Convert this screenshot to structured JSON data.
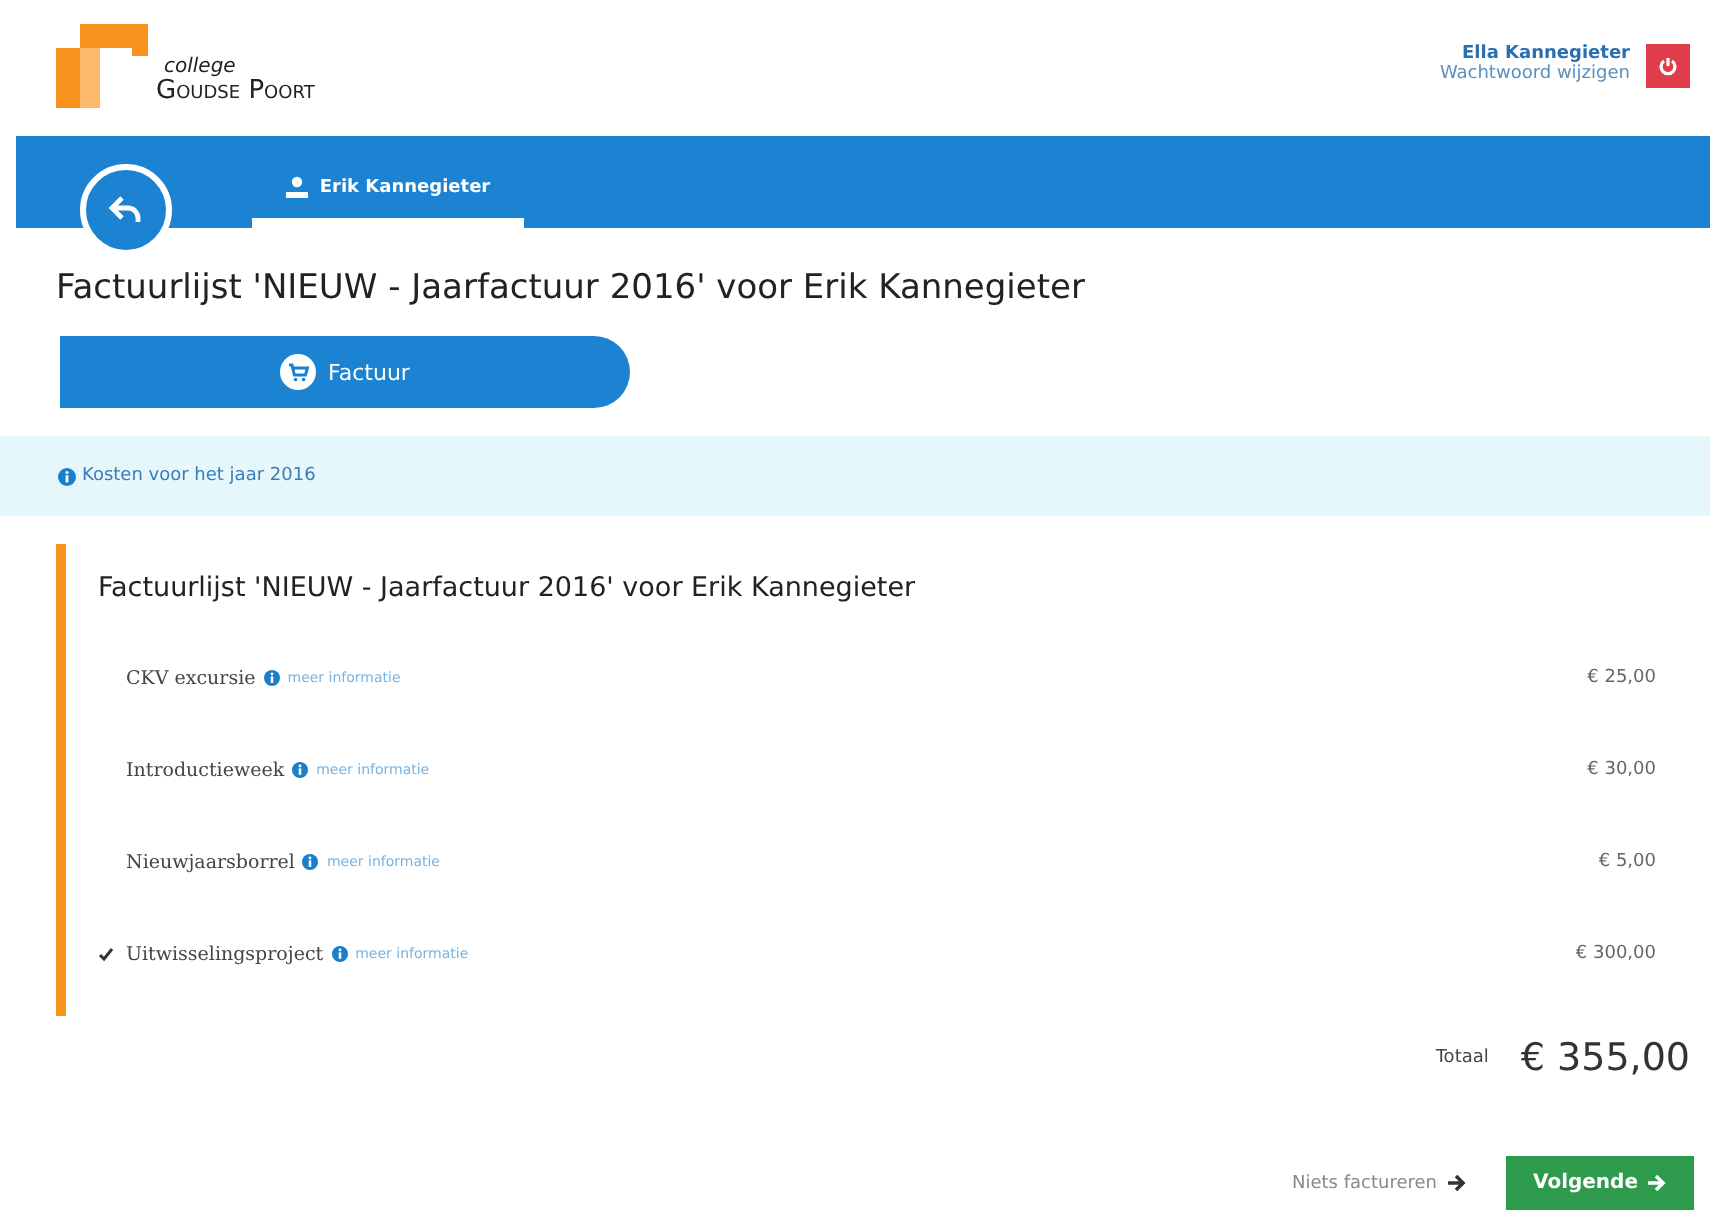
{
  "logo": {
    "small": "college",
    "big": "Goudse Poort"
  },
  "user": {
    "name": "Ella Kannegieter",
    "link": "Wachtwoord wijzigen"
  },
  "student_tab": {
    "label": "Erik Kannegieter",
    "selected": true
  },
  "title": "Factuurlijst 'NIEUW - Jaarfactuur 2016' voor Erik Kannegieter",
  "step": {
    "label": "Factuur"
  },
  "info": "Kosten voor het jaar 2016",
  "card": {
    "title": "Factuurlijst 'NIEUW - Jaarfactuur 2016' voor Erik Kannegieter",
    "items": [
      {
        "name": "CKV excursie",
        "more": "meer informatie",
        "amount": "€ 25,00",
        "checked": false
      },
      {
        "name": "Introductieweek",
        "more": "meer informatie",
        "amount": "€ 30,00",
        "checked": false
      },
      {
        "name": "Nieuwjaarsborrel",
        "more": "meer informatie",
        "amount": "€ 5,00",
        "checked": false
      },
      {
        "name": "Uitwisselingsproject",
        "more": "meer informatie",
        "amount": "€ 300,00",
        "checked": true
      }
    ]
  },
  "total": {
    "label": "Totaal",
    "value": "€ 355,00"
  },
  "buttons": {
    "skip": "Niets factureren",
    "next": "Volgende"
  }
}
